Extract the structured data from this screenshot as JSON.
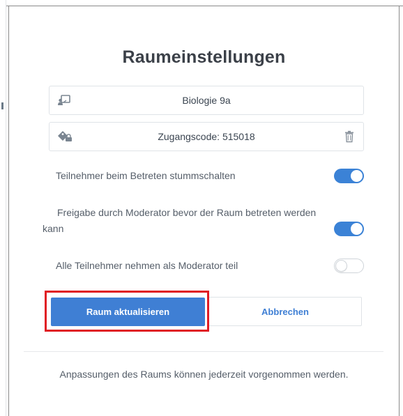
{
  "dialog": {
    "title": "Raumeinstellungen",
    "room_name": {
      "value": "Biologie 9a",
      "icon": "presentation-screen-icon"
    },
    "access_code": {
      "value": "Zugangscode: 515018",
      "icon": "key-code-icon",
      "delete_icon": "trash-icon"
    },
    "toggles": [
      {
        "label": "Teilnehmer beim Betreten stummschalten",
        "state": "on"
      },
      {
        "label_line1": "Freigabe durch Moderator bevor der Raum betreten werden",
        "label_line2": "kann",
        "state": "on"
      },
      {
        "label": "Alle Teilnehmer nehmen als Moderator teil",
        "state": "off"
      }
    ],
    "buttons": {
      "primary": "Raum aktualisieren",
      "secondary": "Abbrechen"
    },
    "footer": "Anpassungen des Raums können jederzeit vorgenommen werden."
  },
  "colors": {
    "accent": "#3f7fd4",
    "toggle_on": "#3b82d6",
    "highlight": "#e01b24"
  }
}
